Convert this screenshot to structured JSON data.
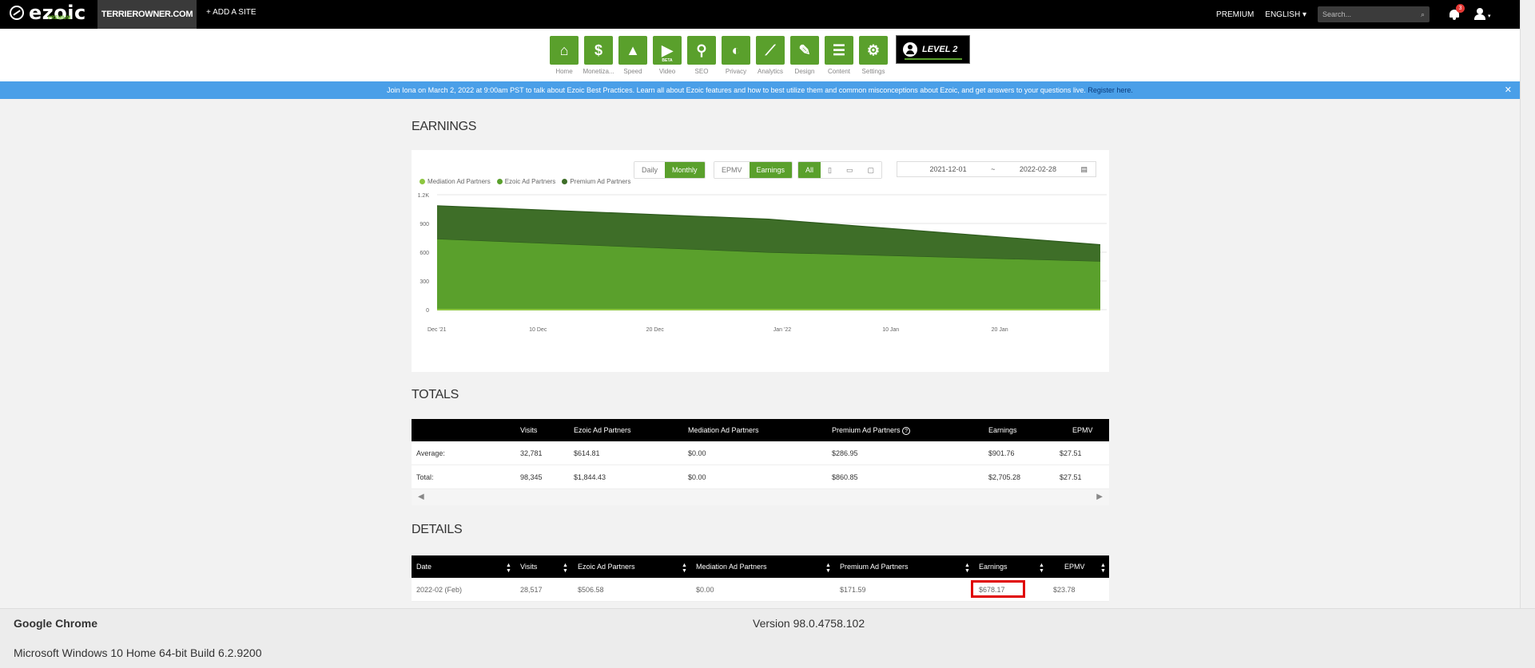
{
  "topbar": {
    "logo_text": "ezoic",
    "logo_sub": "PREMIUM",
    "site_name": "TERRIEROWNER.COM",
    "add_site": "+ ADD A SITE",
    "premium": "PREMIUM",
    "language": "ENGLISH",
    "search_placeholder": "Search...",
    "notification_count": "3"
  },
  "nav": {
    "items": [
      {
        "label": "Home",
        "icon": "home-icon"
      },
      {
        "label": "Monetiza...",
        "icon": "dollar-icon"
      },
      {
        "label": "Speed",
        "icon": "rocket-icon"
      },
      {
        "label": "Video",
        "icon": "video-icon",
        "badge": "BETA"
      },
      {
        "label": "SEO",
        "icon": "search-icon"
      },
      {
        "label": "Privacy",
        "icon": "shield-icon"
      },
      {
        "label": "Analytics",
        "icon": "chart-icon"
      },
      {
        "label": "Design",
        "icon": "design-icon"
      },
      {
        "label": "Content",
        "icon": "content-icon"
      },
      {
        "label": "Settings",
        "icon": "gear-icon"
      }
    ],
    "level": "LEVEL 2"
  },
  "banner": {
    "text": "Join Iona on March 2, 2022 at 9:00am PST to talk about Ezoic Best Practices. Learn all about Ezoic features and how to best utilize them and common misconceptions about Ezoic, and get answers to your questions live.",
    "link": "Register here."
  },
  "earnings": {
    "title": "EARNINGS",
    "buttons": {
      "daily": "Daily",
      "monthly": "Monthly",
      "epmv": "EPMV",
      "earnings": "Earnings",
      "all": "All"
    },
    "date_start": "2021-12-01",
    "date_sep": "~",
    "date_end": "2022-02-28"
  },
  "chart_data": {
    "type": "area",
    "legend": [
      "Mediation Ad Partners",
      "Ezoic Ad Partners",
      "Premium Ad Partners"
    ],
    "colors": {
      "Mediation Ad Partners": "#8cc63f",
      "Ezoic Ad Partners": "#5aa02c",
      "Premium Ad Partners": "#3e6e28"
    },
    "y_ticks": [
      "0",
      "300",
      "600",
      "900",
      "1.2K"
    ],
    "ylim": [
      0,
      1200
    ],
    "x_ticks": [
      "Dec '21",
      "10 Dec",
      "20 Dec",
      "Jan '22",
      "10 Jan",
      "20 Jan"
    ],
    "x": [
      "2021-12-01",
      "2022-01-01",
      "2022-02-01"
    ],
    "stacked": true,
    "series": [
      {
        "name": "Mediation Ad Partners",
        "values": [
          0,
          0,
          0
        ]
      },
      {
        "name": "Ezoic Ad Partners",
        "values": [
          740,
          600,
          506.58
        ]
      },
      {
        "name": "Premium Ad Partners",
        "values": [
          345,
          345,
          171.59
        ]
      }
    ]
  },
  "totals": {
    "title": "TOTALS",
    "headers": [
      "Visits",
      "Ezoic Ad Partners",
      "Mediation Ad Partners",
      "Premium Ad Partners",
      "Earnings",
      "EPMV"
    ],
    "rows": [
      {
        "label": "Average:",
        "visits": "32,781",
        "ezoic": "$614.81",
        "mediation": "$0.00",
        "premium": "$286.95",
        "earnings": "$901.76",
        "epmv": "$27.51"
      },
      {
        "label": "Total:",
        "visits": "98,345",
        "ezoic": "$1,844.43",
        "mediation": "$0.00",
        "premium": "$860.85",
        "earnings": "$2,705.28",
        "epmv": "$27.51"
      }
    ]
  },
  "details": {
    "title": "DETAILS",
    "headers": [
      "Date",
      "Visits",
      "Ezoic Ad Partners",
      "Mediation Ad Partners",
      "Premium Ad Partners",
      "Earnings",
      "EPMV"
    ],
    "rows": [
      {
        "date": "2022-02 (Feb)",
        "visits": "28,517",
        "ezoic": "$506.58",
        "mediation": "$0.00",
        "premium": "$171.59",
        "earnings": "$678.17",
        "epmv": "$23.78"
      }
    ]
  },
  "footer": {
    "browser": "Google Chrome",
    "version": "Version 98.0.4758.102",
    "os": "Microsoft Windows 10 Home 64-bit Build 6.2.9200"
  }
}
